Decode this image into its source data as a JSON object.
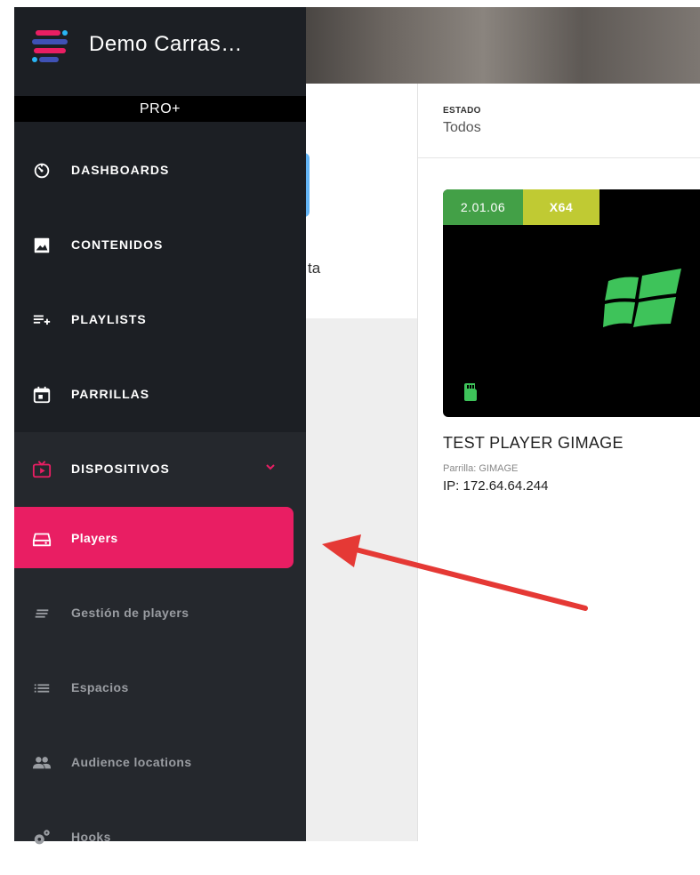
{
  "app": {
    "title": "Demo Carras…",
    "plan": "PRO+"
  },
  "sidebar": {
    "items": [
      {
        "label": "DASHBOARDS",
        "icon": "dashboard-timer-icon"
      },
      {
        "label": "CONTENIDOS",
        "icon": "image-icon"
      },
      {
        "label": "PLAYLISTS",
        "icon": "playlist-add-icon"
      },
      {
        "label": "PARRILLAS",
        "icon": "calendar-icon"
      },
      {
        "label": "DISPOSITIVOS",
        "icon": "tv-icon",
        "expanded": true
      }
    ],
    "sub_items": [
      {
        "label": "Players",
        "icon": "drive-icon",
        "active": true
      },
      {
        "label": "Gestión de players",
        "icon": "notes-icon"
      },
      {
        "label": "Espacios",
        "icon": "list-icon"
      },
      {
        "label": "Audience locations",
        "icon": "people-icon"
      },
      {
        "label": "Hooks",
        "icon": "gears-icon"
      }
    ],
    "accent": "#e91e63",
    "devices_icon_color": "#e91e63"
  },
  "main": {
    "partial_text": "ta",
    "filter": {
      "label": "ESTADO",
      "value": "Todos"
    },
    "player_card": {
      "version": "2.01.06",
      "arch": "X64",
      "os_icon": "windows-icon",
      "storage_icon": "sd-card-icon",
      "name": "TEST PLAYER GIMAGE",
      "schedule": "Parrilla: GIMAGE",
      "ip": "IP: 172.64.64.244",
      "version_color": "#43a047",
      "arch_color": "#c0ca33"
    }
  },
  "annotation": {
    "arrow_color": "#e53935"
  }
}
